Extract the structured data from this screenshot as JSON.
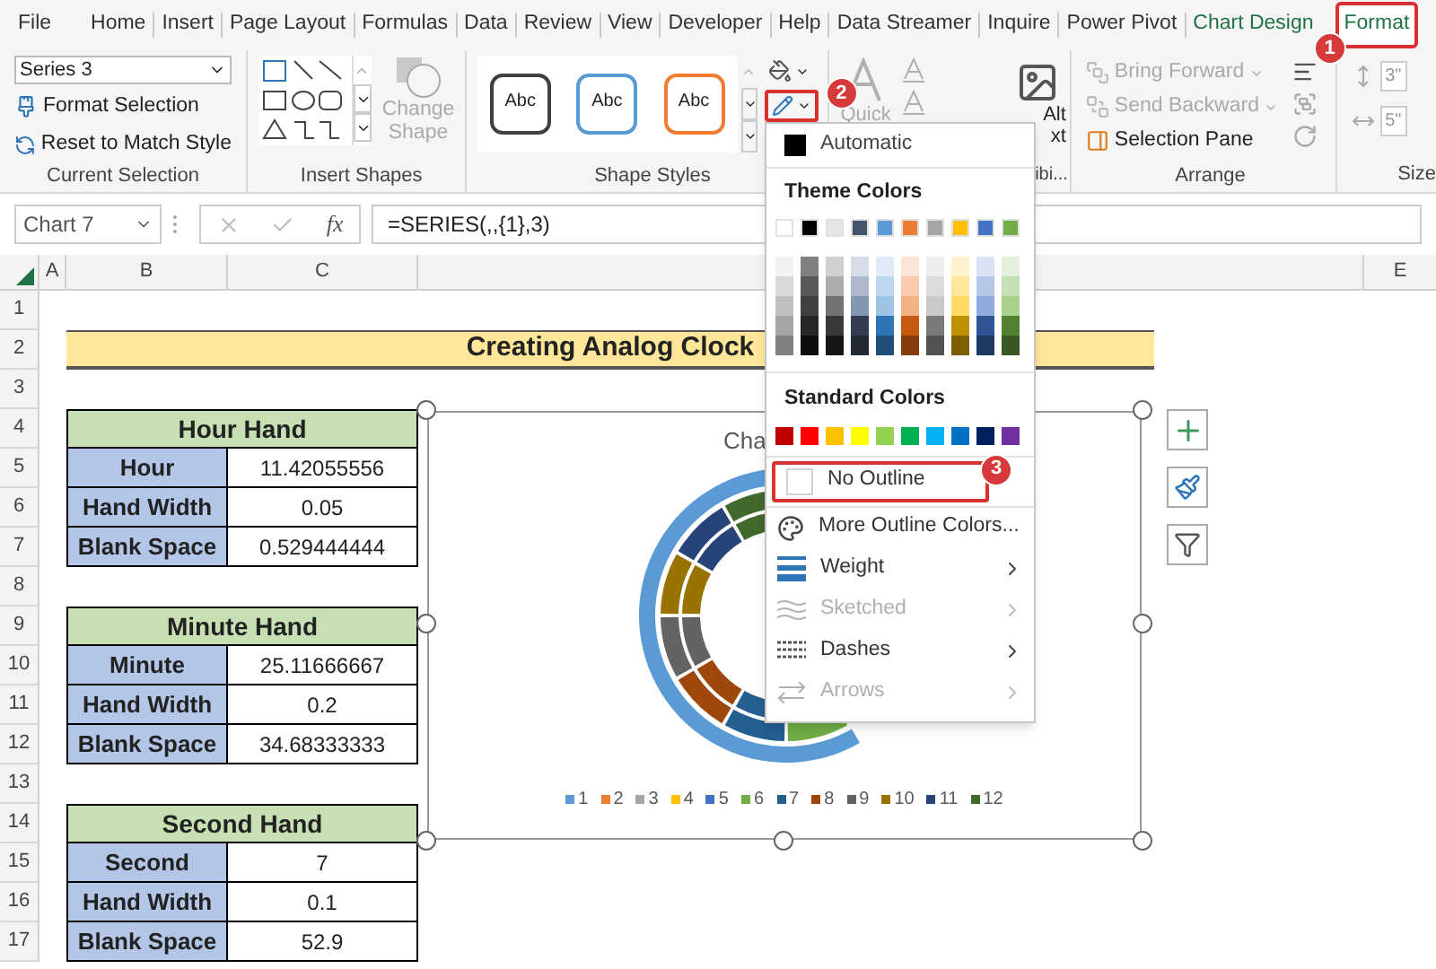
{
  "tabs": [
    {
      "label": "File",
      "selected": false,
      "contextual": false
    },
    {
      "label": "Home",
      "selected": false,
      "contextual": false
    },
    {
      "label": "Insert",
      "selected": false,
      "contextual": false
    },
    {
      "label": "Page Layout",
      "selected": false,
      "contextual": false
    },
    {
      "label": "Formulas",
      "selected": false,
      "contextual": false
    },
    {
      "label": "Data",
      "selected": false,
      "contextual": false
    },
    {
      "label": "Review",
      "selected": false,
      "contextual": false
    },
    {
      "label": "View",
      "selected": false,
      "contextual": false
    },
    {
      "label": "Developer",
      "selected": false,
      "contextual": false
    },
    {
      "label": "Help",
      "selected": false,
      "contextual": false
    },
    {
      "label": "Data Streamer",
      "selected": false,
      "contextual": false
    },
    {
      "label": "Inquire",
      "selected": false,
      "contextual": false
    },
    {
      "label": "Power Pivot",
      "selected": false,
      "contextual": false
    },
    {
      "label": "Chart Design",
      "selected": false,
      "contextual": true
    },
    {
      "label": "Format",
      "selected": true,
      "contextual": true,
      "callout": "1"
    }
  ],
  "ribbon": {
    "current_selection": {
      "dropdown": "Series 3",
      "buttons": [
        "Format Selection",
        "Reset to Match Style"
      ],
      "label": "Current Selection"
    },
    "insert_shapes": {
      "change_shape": "Change Shape",
      "label": "Insert Shapes"
    },
    "shape_styles": {
      "samples": [
        {
          "text": "Abc",
          "color": "#404040"
        },
        {
          "text": "Abc",
          "color": "#5b9bd5"
        },
        {
          "text": "Abc",
          "color": "#ed7d31"
        }
      ],
      "outline_callout": "2",
      "label": "Shape Styles"
    },
    "wordart": {
      "quick_styles": "Quick"
    },
    "accessibility": {
      "alt_text": [
        "Alt",
        "xt"
      ],
      "label": "ibi..."
    },
    "arrange": {
      "buttons": [
        {
          "label": "Bring Forward",
          "disabled": true
        },
        {
          "label": "Send Backward",
          "disabled": true
        },
        {
          "label": "Selection Pane",
          "disabled": false
        }
      ],
      "label": "Arrange"
    },
    "size": {
      "fields": [
        "3\"",
        "5\""
      ],
      "label": "Size"
    }
  },
  "formula_bar": {
    "name_box": "Chart 7",
    "fx": "fx",
    "formula": "=SERIES(,,{1},3)"
  },
  "columns": [
    "A",
    "B",
    "C",
    "E"
  ],
  "rows": [
    "1",
    "2",
    "3",
    "4",
    "5",
    "6",
    "7",
    "8",
    "9",
    "10",
    "11",
    "12",
    "13",
    "14",
    "15",
    "16",
    "17"
  ],
  "title": "Creating Analog Clock",
  "tables": [
    {
      "heading": "Hour Hand",
      "rows": [
        {
          "label": "Hour",
          "value": "11.42055556"
        },
        {
          "label": "Hand Width",
          "value": "0.05"
        },
        {
          "label": "Blank Space",
          "value": "0.529444444"
        }
      ]
    },
    {
      "heading": "Minute Hand",
      "rows": [
        {
          "label": "Minute",
          "value": "25.11666667"
        },
        {
          "label": "Hand Width",
          "value": "0.2"
        },
        {
          "label": "Blank Space",
          "value": "34.68333333"
        }
      ]
    },
    {
      "heading": "Second Hand",
      "rows": [
        {
          "label": "Second",
          "value": "7"
        },
        {
          "label": "Hand Width",
          "value": "0.1"
        },
        {
          "label": "Blank Space",
          "value": "52.9"
        }
      ]
    }
  ],
  "chart": {
    "title": "Cha",
    "legend": [
      {
        "label": "1",
        "color": "#5b9bd5"
      },
      {
        "label": "2",
        "color": "#ed7d31"
      },
      {
        "label": "3",
        "color": "#a5a5a5"
      },
      {
        "label": "4",
        "color": "#ffc000"
      },
      {
        "label": "5",
        "color": "#4472c4"
      },
      {
        "label": "6",
        "color": "#70ad47"
      },
      {
        "label": "7",
        "color": "#255e91"
      },
      {
        "label": "8",
        "color": "#9e480e"
      },
      {
        "label": "9",
        "color": "#636363"
      },
      {
        "label": "10",
        "color": "#997300"
      },
      {
        "label": "11",
        "color": "#264478"
      },
      {
        "label": "12",
        "color": "#43682b"
      }
    ]
  },
  "outline_menu": {
    "automatic": "Automatic",
    "theme_label": "Theme Colors",
    "theme_colors": [
      {
        "color": "#ffffff",
        "shades": [
          {
            "color": "#f2f2f2"
          },
          {
            "color": "#d9d9d9"
          },
          {
            "color": "#bfbfbf"
          },
          {
            "color": "#a6a6a6"
          },
          {
            "color": "#808080"
          }
        ]
      },
      {
        "color": "#000000",
        "shades": [
          {
            "color": "#808080"
          },
          {
            "color": "#595959"
          },
          {
            "color": "#404040"
          },
          {
            "color": "#262626"
          },
          {
            "color": "#0d0d0d"
          }
        ]
      },
      {
        "color": "#e7e6e6",
        "shades": [
          {
            "color": "#d0cece"
          },
          {
            "color": "#aeaaaa"
          },
          {
            "color": "#757171"
          },
          {
            "color": "#3a3838"
          },
          {
            "color": "#171616"
          }
        ]
      },
      {
        "color": "#44546a",
        "shades": [
          {
            "color": "#d6dce5"
          },
          {
            "color": "#adb9ca"
          },
          {
            "color": "#8497b0"
          },
          {
            "color": "#333f50"
          },
          {
            "color": "#222a35"
          }
        ]
      },
      {
        "color": "#5b9bd5",
        "shades": [
          {
            "color": "#deebf7"
          },
          {
            "color": "#bdd7ee"
          },
          {
            "color": "#9dc3e6"
          },
          {
            "color": "#2e75b6"
          },
          {
            "color": "#1f4e79"
          }
        ]
      },
      {
        "color": "#ed7d31",
        "shades": [
          {
            "color": "#fbe5d6"
          },
          {
            "color": "#f8cbad"
          },
          {
            "color": "#f4b183"
          },
          {
            "color": "#c55a11"
          },
          {
            "color": "#843c0c"
          }
        ]
      },
      {
        "color": "#a5a5a5",
        "shades": [
          {
            "color": "#ededed"
          },
          {
            "color": "#dbdbdb"
          },
          {
            "color": "#c9c9c9"
          },
          {
            "color": "#7b7b7b"
          },
          {
            "color": "#525252"
          }
        ]
      },
      {
        "color": "#ffc000",
        "shades": [
          {
            "color": "#fff2cc"
          },
          {
            "color": "#ffe699"
          },
          {
            "color": "#ffd966"
          },
          {
            "color": "#bf9000"
          },
          {
            "color": "#7f6000"
          }
        ]
      },
      {
        "color": "#4472c4",
        "shades": [
          {
            "color": "#dae3f3"
          },
          {
            "color": "#b4c7e7"
          },
          {
            "color": "#8faadc"
          },
          {
            "color": "#2f5597"
          },
          {
            "color": "#203864"
          }
        ]
      },
      {
        "color": "#70ad47",
        "shades": [
          {
            "color": "#e2f0d9"
          },
          {
            "color": "#c5e0b4"
          },
          {
            "color": "#a9d18e"
          },
          {
            "color": "#548235"
          },
          {
            "color": "#385723"
          }
        ]
      }
    ],
    "standard_label": "Standard Colors",
    "standard_colors": [
      {
        "color": "#c00000"
      },
      {
        "color": "#ff0000"
      },
      {
        "color": "#ffc000"
      },
      {
        "color": "#ffff00"
      },
      {
        "color": "#92d050"
      },
      {
        "color": "#00b050"
      },
      {
        "color": "#00b0f0"
      },
      {
        "color": "#0070c0"
      },
      {
        "color": "#002060"
      },
      {
        "color": "#7030a0"
      }
    ],
    "items": [
      {
        "label": "No Outline",
        "kind": "none",
        "disabled": false,
        "submenu": false,
        "callout": "3"
      },
      {
        "label": "More Outline Colors...",
        "kind": "colors",
        "disabled": false,
        "submenu": false
      },
      {
        "label": "Weight",
        "kind": "weight",
        "disabled": false,
        "submenu": true
      },
      {
        "label": "Sketched",
        "kind": "sketched",
        "disabled": true,
        "submenu": true
      },
      {
        "label": "Dashes",
        "kind": "dashes",
        "disabled": false,
        "submenu": true
      },
      {
        "label": "Arrows",
        "kind": "arrows",
        "disabled": true,
        "submenu": true
      }
    ]
  }
}
